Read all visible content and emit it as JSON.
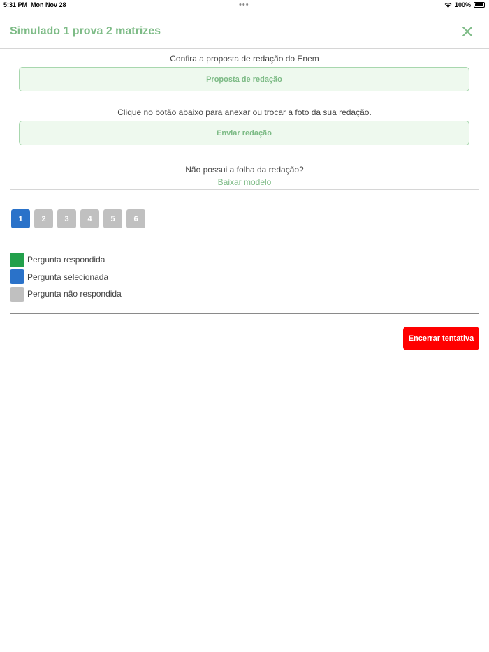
{
  "status_bar": {
    "time": "5:31 PM",
    "date": "Mon Nov 28",
    "dots": "•••",
    "battery": "100%"
  },
  "header": {
    "title": "Simulado 1 prova 2 matrizes"
  },
  "proposal": {
    "prompt": "Confira a proposta de redação do Enem",
    "button_label": "Proposta de redação"
  },
  "upload": {
    "prompt": "Clique no botão abaixo para anexar ou trocar a foto da sua redação.",
    "button_label": "Enviar redação"
  },
  "template": {
    "question": "Não possui a folha da redação?",
    "link_label": "Baixar modelo"
  },
  "questions": [
    {
      "label": "1",
      "state": "selected"
    },
    {
      "label": "2",
      "state": "unanswered"
    },
    {
      "label": "3",
      "state": "unanswered"
    },
    {
      "label": "4",
      "state": "unanswered"
    },
    {
      "label": "5",
      "state": "unanswered"
    },
    {
      "label": "6",
      "state": "unanswered"
    }
  ],
  "legend": [
    {
      "label": "Pergunta respondida",
      "color": "#22a04b"
    },
    {
      "label": "Pergunta selecionada",
      "color": "#2a72c9"
    },
    {
      "label": "Pergunta não respondida",
      "color": "#c0c0c0"
    }
  ],
  "colors": {
    "brand_green": "#7dbb86",
    "selected": "#2a72c9",
    "unanswered": "#c0c0c0",
    "answered": "#22a04b",
    "danger": "#ff0000"
  },
  "end_button_label": "Encerrar tentativa"
}
